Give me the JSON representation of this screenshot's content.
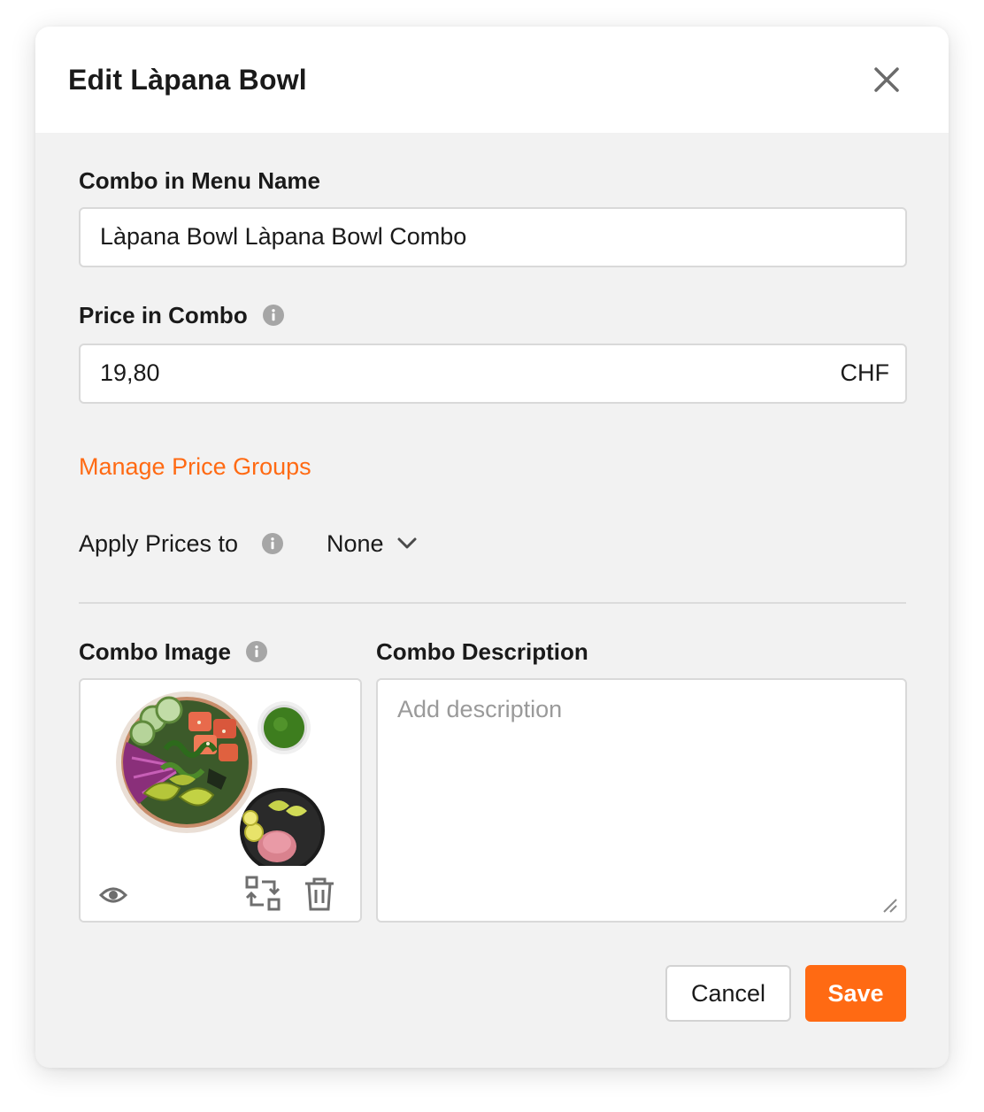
{
  "modal": {
    "title": "Edit Làpana Bowl",
    "close_icon": "close-icon"
  },
  "form": {
    "name_label": "Combo in Menu Name",
    "name_value": "Làpana Bowl Làpana Bowl Combo",
    "price_label": "Price in Combo",
    "price_value": "19,80",
    "price_currency": "CHF",
    "manage_link": "Manage Price Groups",
    "apply_label": "Apply Prices to",
    "apply_value": "None",
    "image_label": "Combo Image",
    "description_label": "Combo Description",
    "description_placeholder": "Add description"
  },
  "image_tools": {
    "preview": "eye-icon",
    "replace": "replace-icon",
    "delete": "trash-icon"
  },
  "actions": {
    "cancel": "Cancel",
    "save": "Save"
  },
  "colors": {
    "accent": "#ff6a13",
    "background": "#f2f2f2",
    "border": "#d9d9d9",
    "placeholder": "#9a9a9a",
    "info_icon": "#a6a6a6"
  }
}
